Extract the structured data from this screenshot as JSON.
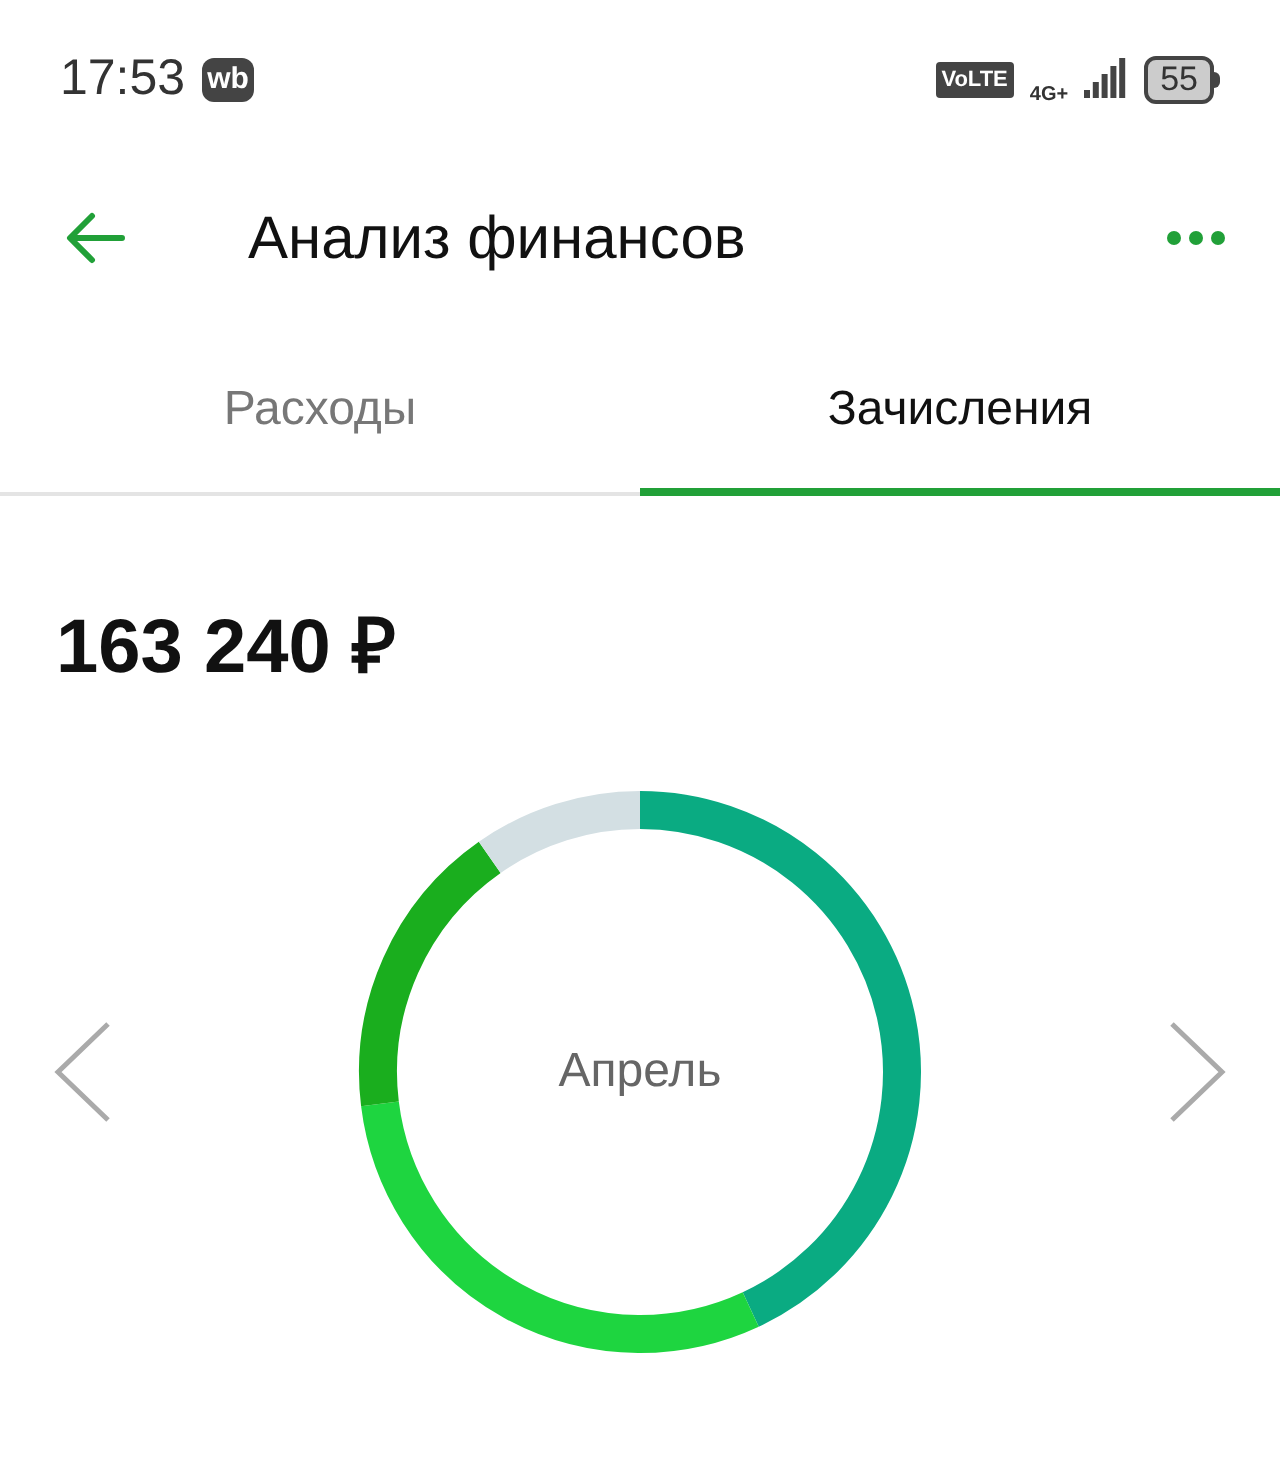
{
  "status_bar": {
    "time": "17:53",
    "app_badge": "wb",
    "network_badge": "VoLTE",
    "network_type": "4G+",
    "battery": "55"
  },
  "header": {
    "title": "Анализ финансов"
  },
  "tabs": [
    {
      "label": "Расходы",
      "selected": false
    },
    {
      "label": "Зачисления",
      "selected": true
    }
  ],
  "total": "163 240 ₽",
  "chart": {
    "center_label": "Апрель"
  }
}
